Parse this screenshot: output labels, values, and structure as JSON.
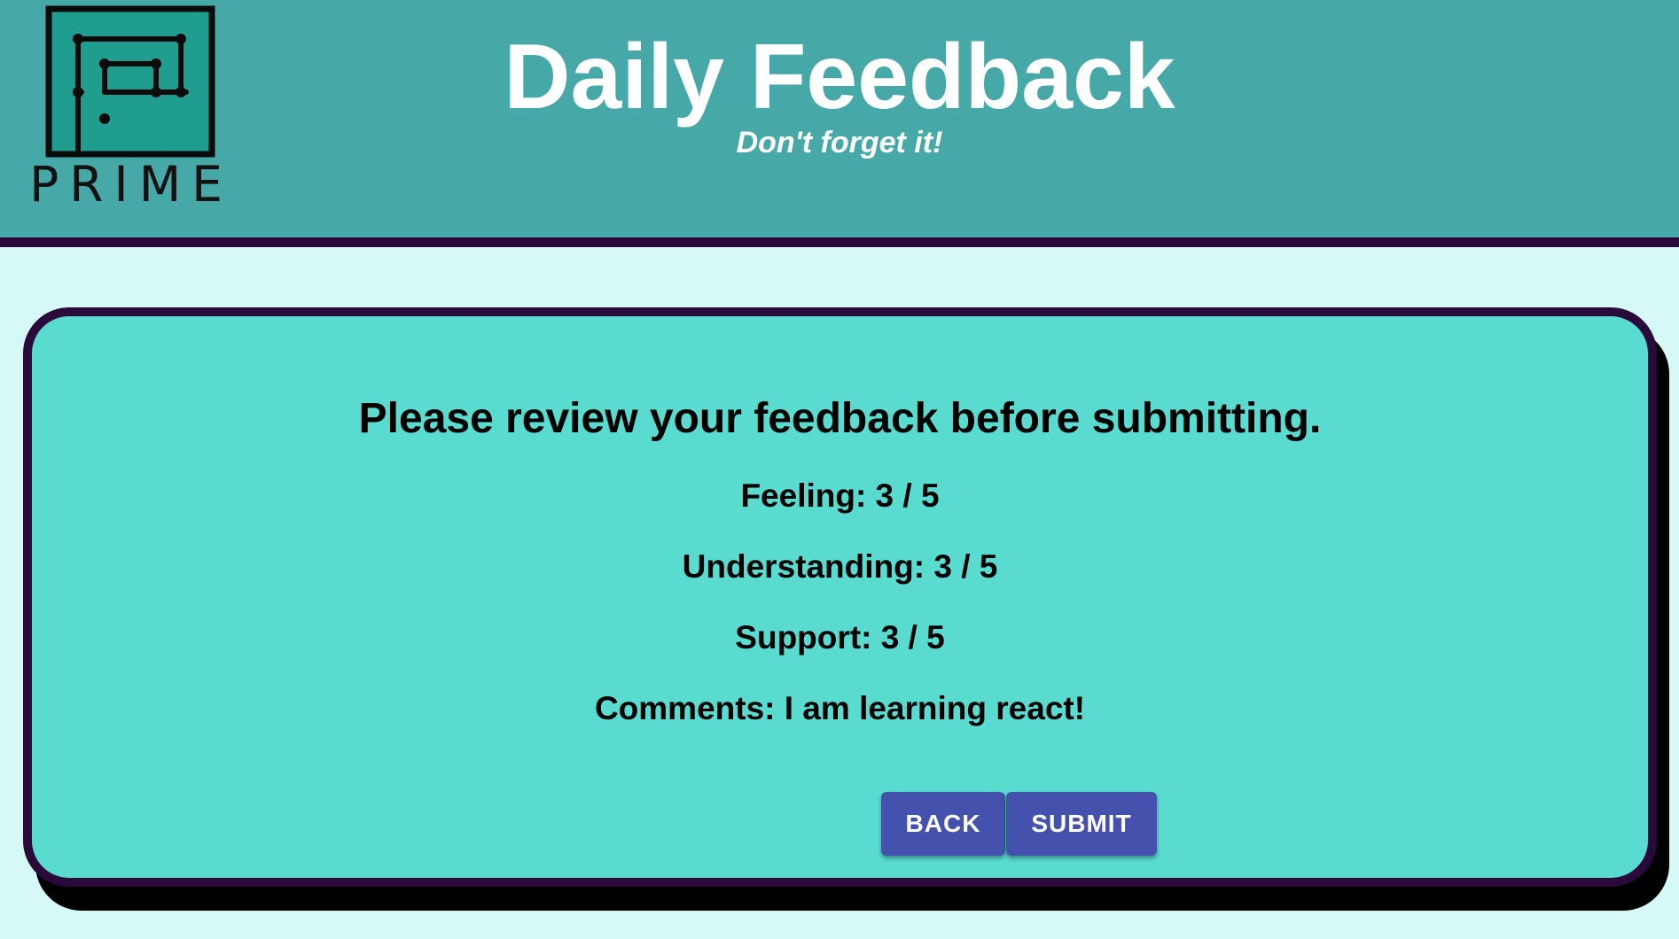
{
  "header": {
    "logo_text": "PRIME",
    "title": "Daily Feedback",
    "subtitle": "Don't forget it!"
  },
  "review": {
    "heading": "Please review your feedback before submitting.",
    "feeling": "Feeling: 3 / 5",
    "understanding": "Understanding: 3 / 5",
    "support": "Support: 3 / 5",
    "comments": "Comments: I am learning react!"
  },
  "buttons": {
    "back": "BACK",
    "submit": "SUBMIT"
  },
  "colors": {
    "header_bg": "#47a8a8",
    "page_bg": "#d4f9f7",
    "card_bg": "#59dbcf",
    "border": "#2a0a3a",
    "button": "#4452ad"
  },
  "icons": {
    "logo": "prime-maze-logo-icon"
  }
}
